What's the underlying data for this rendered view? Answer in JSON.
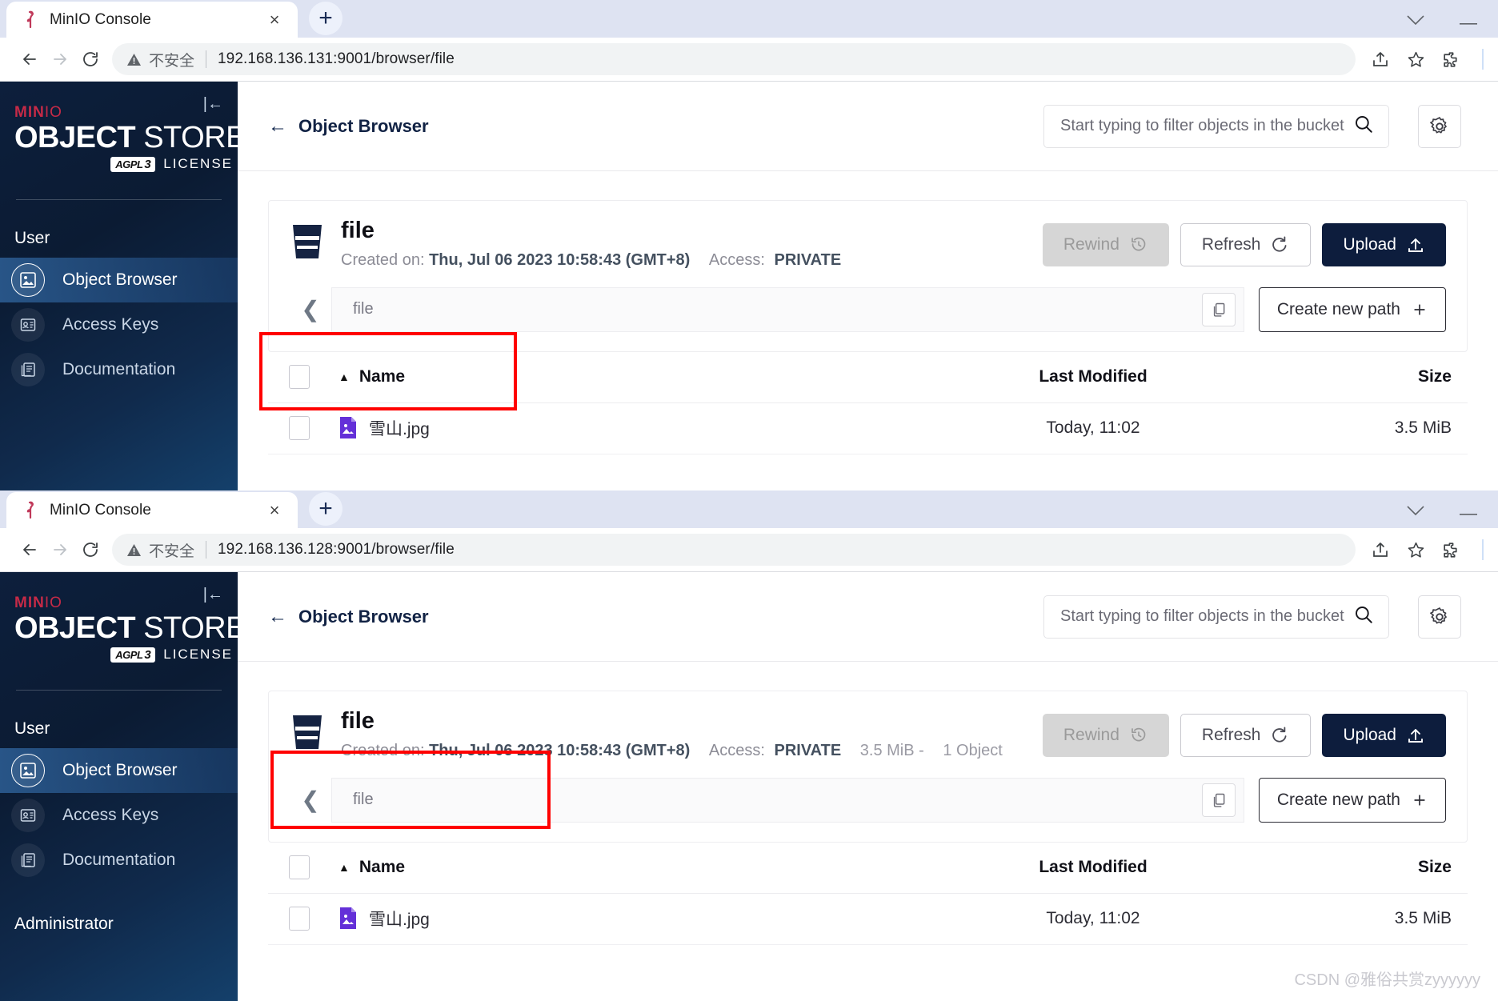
{
  "windows": [
    {
      "tab": {
        "title": "MinIO Console",
        "favicon": "minio-flamingo-icon",
        "close": "×",
        "newtab": "+"
      },
      "nav": {
        "back": "←",
        "forward": "→",
        "reload": "↻",
        "insecure_label": "不安全",
        "url": "192.168.136.131:9001/browser/file",
        "share": "share-icon",
        "bookmark": "star-icon",
        "extensions": "puzzle-icon"
      },
      "sidebar": {
        "collapse": "|←",
        "brand_minio_min": "MIN",
        "brand_minio_io": "IO",
        "brand_object": "OBJECT",
        "brand_store": "STORE",
        "agpl": "AGPL",
        "agpl_v": "3",
        "license": "LICENSE",
        "section_user": "User",
        "items": [
          {
            "label": "Object Browser",
            "icon": "object-browser-icon",
            "active": true
          },
          {
            "label": "Access Keys",
            "icon": "access-keys-icon",
            "active": false
          },
          {
            "label": "Documentation",
            "icon": "documentation-icon",
            "active": false
          }
        ],
        "section_admin": ""
      },
      "header": {
        "back_arrow": "←",
        "title": "Object Browser",
        "filter_placeholder": "Start typing to filter objects in the bucket",
        "filter_value": "",
        "search_icon": "search-icon",
        "gear_icon": "gear-icon"
      },
      "bucket": {
        "name": "file",
        "created_label": "Created on:",
        "created_value": "Thu, Jul 06 2023 10:58:43 (GMT+8)",
        "access_label": "Access:",
        "access_value": "PRIVATE",
        "size_summary": "",
        "object_summary": ""
      },
      "actions": {
        "rewind": "Rewind",
        "rewind_icon": "rewind-clock-icon",
        "refresh": "Refresh",
        "refresh_icon": "refresh-icon",
        "upload": "Upload",
        "upload_icon": "upload-icon"
      },
      "path": {
        "back_icon": "chevron-left-icon",
        "text": "file",
        "copy_icon": "copy-icon",
        "create_new_path": "Create new path",
        "create_icon": "plus-icon"
      },
      "table": {
        "columns": [
          "Name",
          "Last Modified",
          "Size"
        ],
        "sort_caret": "▲",
        "rows": [
          {
            "name": "雪山.jpg",
            "modified": "Today, 11:02",
            "size": "3.5 MiB",
            "icon": "image-file-icon"
          }
        ]
      }
    },
    {
      "tab": {
        "title": "MinIO Console",
        "favicon": "minio-flamingo-icon",
        "close": "×",
        "newtab": "+"
      },
      "nav": {
        "back": "←",
        "forward": "→",
        "reload": "↻",
        "insecure_label": "不安全",
        "url": "192.168.136.128:9001/browser/file",
        "share": "share-icon",
        "bookmark": "star-icon",
        "extensions": "puzzle-icon"
      },
      "sidebar": {
        "collapse": "|←",
        "brand_minio_min": "MIN",
        "brand_minio_io": "IO",
        "brand_object": "OBJECT",
        "brand_store": "STORE",
        "agpl": "AGPL",
        "agpl_v": "3",
        "license": "LICENSE",
        "section_user": "User",
        "items": [
          {
            "label": "Object Browser",
            "icon": "object-browser-icon",
            "active": true
          },
          {
            "label": "Access Keys",
            "icon": "access-keys-icon",
            "active": false
          },
          {
            "label": "Documentation",
            "icon": "documentation-icon",
            "active": false
          }
        ],
        "section_admin": "Administrator"
      },
      "header": {
        "back_arrow": "←",
        "title": "Object Browser",
        "filter_placeholder": "Start typing to filter objects in the bucket",
        "filter_value": "",
        "search_icon": "search-icon",
        "gear_icon": "gear-icon"
      },
      "bucket": {
        "name": "file",
        "created_label": "Created on:",
        "created_value": "Thu, Jul 06 2023 10:58:43 (GMT+8)",
        "access_label": "Access:",
        "access_value": "PRIVATE",
        "size_summary": "3.5 MiB -",
        "object_summary": "1 Object"
      },
      "actions": {
        "rewind": "Rewind",
        "rewind_icon": "rewind-clock-icon",
        "refresh": "Refresh",
        "refresh_icon": "refresh-icon",
        "upload": "Upload",
        "upload_icon": "upload-icon"
      },
      "path": {
        "back_icon": "chevron-left-icon",
        "text": "file",
        "copy_icon": "copy-icon",
        "create_new_path": "Create new path",
        "create_icon": "plus-icon"
      },
      "table": {
        "columns": [
          "Name",
          "Last Modified",
          "Size"
        ],
        "sort_caret": "▲",
        "rows": [
          {
            "name": "雪山.jpg",
            "modified": "Today, 11:02",
            "size": "3.5 MiB",
            "icon": "image-file-icon"
          }
        ]
      }
    }
  ],
  "watermark": "CSDN @雅俗共赏zyyyyyy",
  "colors": {
    "accent_dark": "#0d1d3d",
    "annotation_red": "#ff0000",
    "tab_strip": "#dee3f2",
    "sidebar_active": "#2d5f96"
  }
}
